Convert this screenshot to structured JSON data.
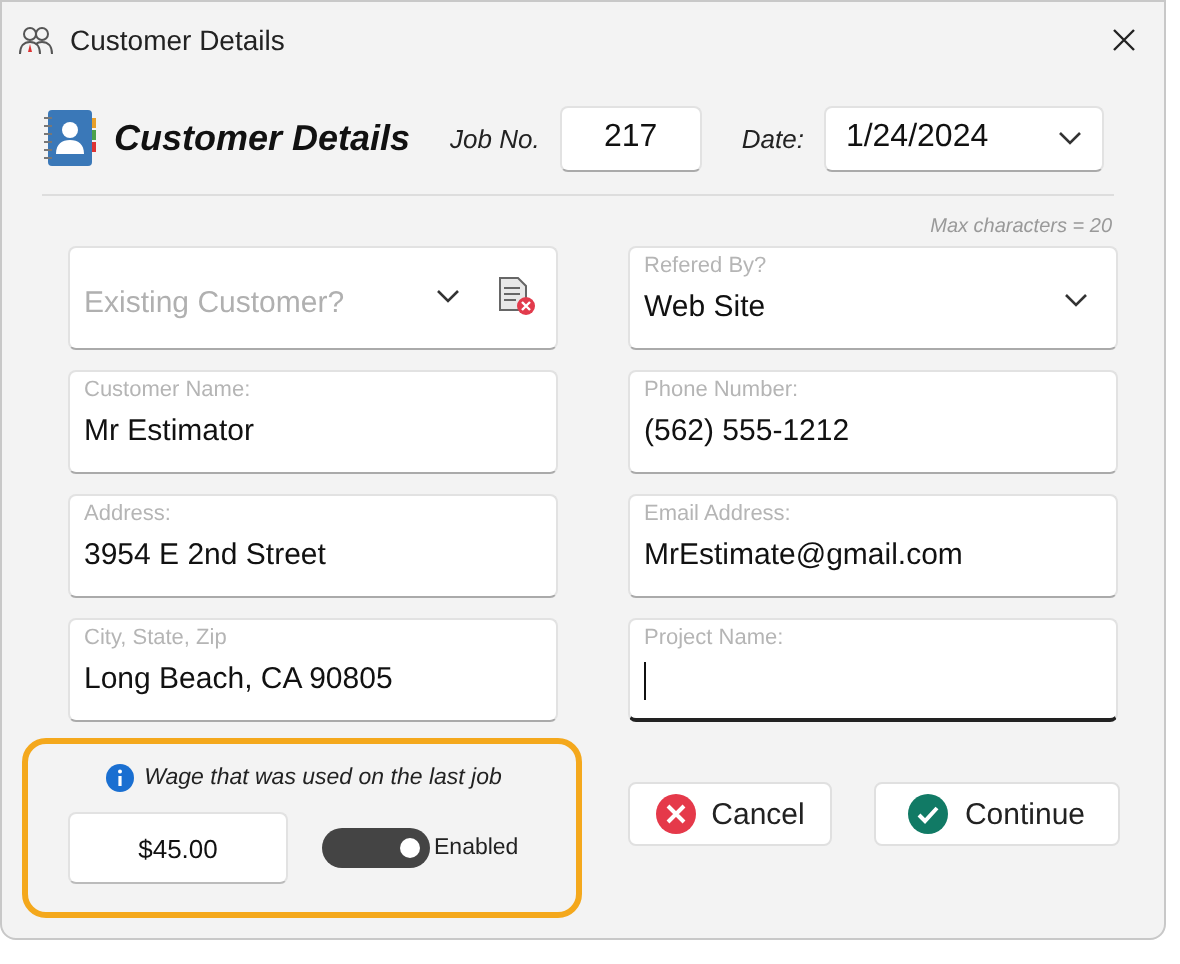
{
  "window": {
    "title": "Customer Details"
  },
  "header": {
    "title": "Customer Details",
    "job_label": "Job No.",
    "job_value": "217",
    "date_label": "Date:",
    "date_value": "1/24/2024"
  },
  "max_note": "Max characters = 20",
  "existing_customer": {
    "kind": "combo",
    "placeholder": "Existing Customer?",
    "focused": false
  },
  "referred_by": {
    "kind": "dropdown",
    "label": "Refered By?",
    "value": "Web Site",
    "focused": false
  },
  "fields": [
    {
      "kind": "text",
      "label": "Customer Name:",
      "value": "Mr Estimator",
      "focused": false
    },
    {
      "kind": "text",
      "label": "Phone Number:",
      "value": "(562) 555-1212",
      "focused": false
    },
    {
      "kind": "text",
      "label": "Address:",
      "value": "3954 E 2nd Street",
      "focused": false
    },
    {
      "kind": "text",
      "label": "Email Address:",
      "value": "MrEstimate@gmail.com",
      "focused": false
    },
    {
      "kind": "text",
      "label": "City, State, Zip",
      "value": "Long Beach, CA 90805",
      "focused": false
    },
    {
      "kind": "text",
      "label": "Project Name:",
      "focused": true
    }
  ],
  "wage": {
    "note": "Wage that was used on the last job",
    "value": "$45.00",
    "toggle": {
      "label": "Enabled",
      "on": true
    }
  },
  "buttons": [
    {
      "kind": "cancel",
      "label": "Cancel"
    },
    {
      "kind": "continue",
      "label": "Continue"
    }
  ]
}
